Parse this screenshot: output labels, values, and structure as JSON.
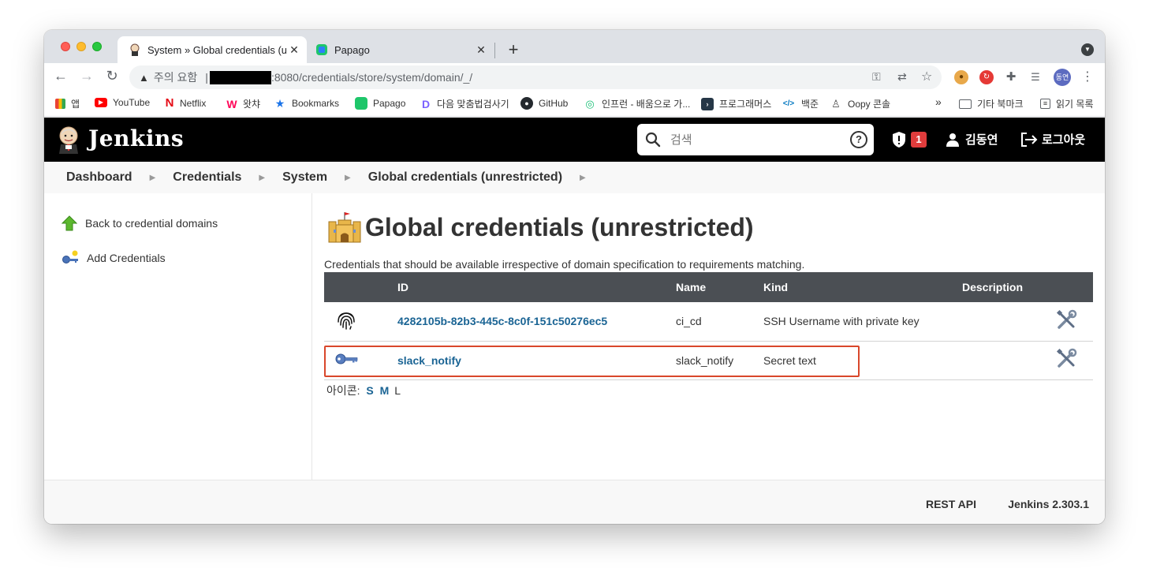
{
  "browser": {
    "tabs": [
      {
        "title": "System » Global credentials (u",
        "close": "✕"
      },
      {
        "title": "Papago",
        "close": "✕"
      }
    ],
    "new_tab": "+",
    "address": {
      "security_label": "주의 요함",
      "url": ":8080/credentials/store/system/domain/_/"
    }
  },
  "bookmarks": [
    {
      "label": "앱",
      "icon": "apps-grid-icon"
    },
    {
      "label": "YouTube",
      "icon": "youtube-icon"
    },
    {
      "label": "Netflix",
      "icon": "netflix-icon"
    },
    {
      "label": "왓챠",
      "icon": "watcha-icon"
    },
    {
      "label": "Bookmarks",
      "icon": "star-icon"
    },
    {
      "label": "Papago",
      "icon": "papago-icon"
    },
    {
      "label": "다음 맞춤법검사기",
      "icon": "daum-icon"
    },
    {
      "label": "GitHub",
      "icon": "github-icon"
    },
    {
      "label": "인프런 - 배움으로 가...",
      "icon": "inflearn-icon"
    },
    {
      "label": "프로그래머스",
      "icon": "programmers-icon"
    },
    {
      "label": "백준",
      "icon": "code-icon"
    },
    {
      "label": "Oopy 콘솔",
      "icon": "oopy-icon"
    }
  ],
  "bookmarks_overflow": "»",
  "bookmarks_right": [
    {
      "label": "기타 북마크",
      "icon": "folder-icon"
    },
    {
      "label": "읽기 목록",
      "icon": "reading-list-icon"
    }
  ],
  "profile_initials": "동연",
  "jenkins": {
    "brand": "Jenkins",
    "search_placeholder": "검색",
    "help": "?",
    "security_badge": "1",
    "user": "김동연",
    "logout": "로그아웃"
  },
  "breadcrumb": [
    "Dashboard",
    "Credentials",
    "System",
    "Global credentials (unrestricted)"
  ],
  "sidepanel": {
    "back": "Back to credential domains",
    "add": "Add Credentials"
  },
  "main": {
    "title": "Global credentials (unrestricted)",
    "description": "Credentials that should be available irrespective of domain specification to requirements matching.",
    "columns": {
      "id": "ID",
      "name": "Name",
      "kind": "Kind",
      "description": "Description"
    },
    "rows": [
      {
        "icon": "fingerprint-icon",
        "id": "4282105b-82b3-445c-8c0f-151c50276ec5",
        "name": "ci_cd",
        "kind": "SSH Username with private key",
        "description": ""
      },
      {
        "icon": "key-icon",
        "id": "slack_notify",
        "name": "slack_notify",
        "kind": "Secret text",
        "description": ""
      }
    ],
    "icon_size_label": "아이콘:",
    "icon_sizes": [
      "S",
      "M",
      "L"
    ]
  },
  "footer": {
    "rest_api": "REST API",
    "version": "Jenkins 2.303.1"
  },
  "colors": {
    "jenkins_header": "#000000",
    "table_header": "#4b4f54",
    "link": "#1a6494",
    "highlight_border": "#d9472b",
    "badge": "#e03c3c"
  }
}
